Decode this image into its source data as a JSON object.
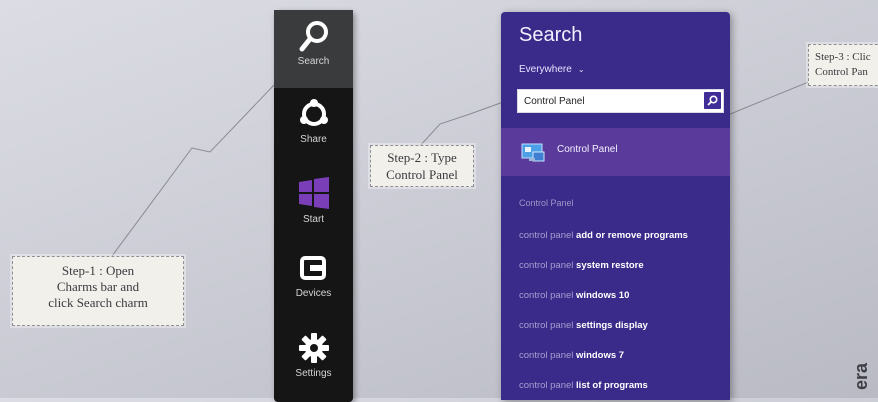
{
  "callouts": {
    "step1": {
      "line1": "Step-1 : Open",
      "line2": "Charms bar and",
      "line3": "click Search charm"
    },
    "step2": {
      "line1": "Step-2 : Type",
      "line2": "Control Panel"
    },
    "step3": {
      "line1": "Step-3 : Clic",
      "line2": "Control Pan"
    }
  },
  "charms": {
    "items": [
      {
        "label": "Search",
        "icon": "search-icon"
      },
      {
        "label": "Share",
        "icon": "share-icon"
      },
      {
        "label": "Start",
        "icon": "windows-logo-icon"
      },
      {
        "label": "Devices",
        "icon": "devices-icon"
      },
      {
        "label": "Settings",
        "icon": "gear-icon"
      }
    ],
    "active": "Search"
  },
  "search_pane": {
    "title": "Search",
    "scope": "Everywhere",
    "query": "Control Panel",
    "top_result": "Control Panel",
    "suggestions_header": "Control Panel",
    "suggestions": [
      {
        "prefix": "control panel",
        "suffix": "add or remove programs"
      },
      {
        "prefix": "control panel",
        "suffix": "system restore"
      },
      {
        "prefix": "control panel",
        "suffix": "windows 10"
      },
      {
        "prefix": "control panel",
        "suffix": "settings display"
      },
      {
        "prefix": "control panel",
        "suffix": "windows 7"
      },
      {
        "prefix": "control panel",
        "suffix": "list of programs"
      }
    ]
  },
  "watermark": "era",
  "colors": {
    "pane_bg": "#3a2a8a",
    "result_highlight": "#5a3a9a",
    "charms_bg": "#151515"
  }
}
